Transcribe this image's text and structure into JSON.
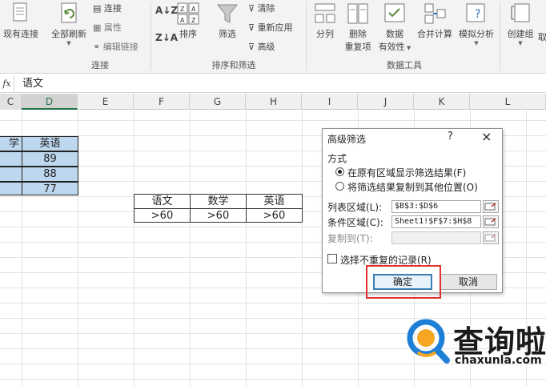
{
  "ribbon": {
    "existing_connections": "现有连接",
    "refresh_all": "全部刷新",
    "connections": "连接",
    "properties": "属性",
    "edit_links": "编辑链接",
    "group_connections": "连接",
    "sort": "排序",
    "filter": "筛选",
    "clear": "清除",
    "reapply": "重新应用",
    "advanced": "高级",
    "group_sort_filter": "排序和筛选",
    "text_to_columns": "分列",
    "remove_duplicates_1": "删除",
    "remove_duplicates_2": "重复项",
    "data_validation_1": "数据",
    "data_validation_2": "有效性",
    "consolidate": "合并计算",
    "what_if": "模拟分析",
    "group_data_tools": "数据工具",
    "group": "创建组",
    "ungroup": "取"
  },
  "formula_bar": {
    "fx": "fx",
    "content": "语文"
  },
  "columns": [
    "C",
    "D",
    "E",
    "F",
    "G",
    "H",
    "I",
    "J",
    "K",
    "L"
  ],
  "table": {
    "header_partial": "学",
    "header": "英语",
    "values": [
      "89",
      "88",
      "77"
    ]
  },
  "criteria": {
    "headers": [
      "语文",
      "数学",
      "英语"
    ],
    "conditions": [
      ">60",
      ">60",
      ">60"
    ]
  },
  "dialog": {
    "title": "高级筛选",
    "help": "?",
    "close": "×",
    "method_label": "方式",
    "option_in_place": "在原有区域显示筛选结果(F)",
    "option_copy": "将筛选结果复制到其他位置(O)",
    "list_range_label": "列表区域(L):",
    "list_range_value": "$B$3:$D$6",
    "criteria_range_label": "条件区域(C):",
    "criteria_range_value": "Sheet1!$F$7:$H$8",
    "copy_to_label": "复制到(T):",
    "copy_to_value": "",
    "unique_records": "选择不重复的记录(R)",
    "ok": "确定",
    "cancel": "取消"
  },
  "watermark": {
    "text": "查询啦",
    "url": "chaxunla.com"
  },
  "colors": {
    "accent_green": "#217346",
    "selection_blue": "#bdd7ee",
    "highlight_red": "#e03030",
    "watermark_blue": "#1e7fd6"
  }
}
